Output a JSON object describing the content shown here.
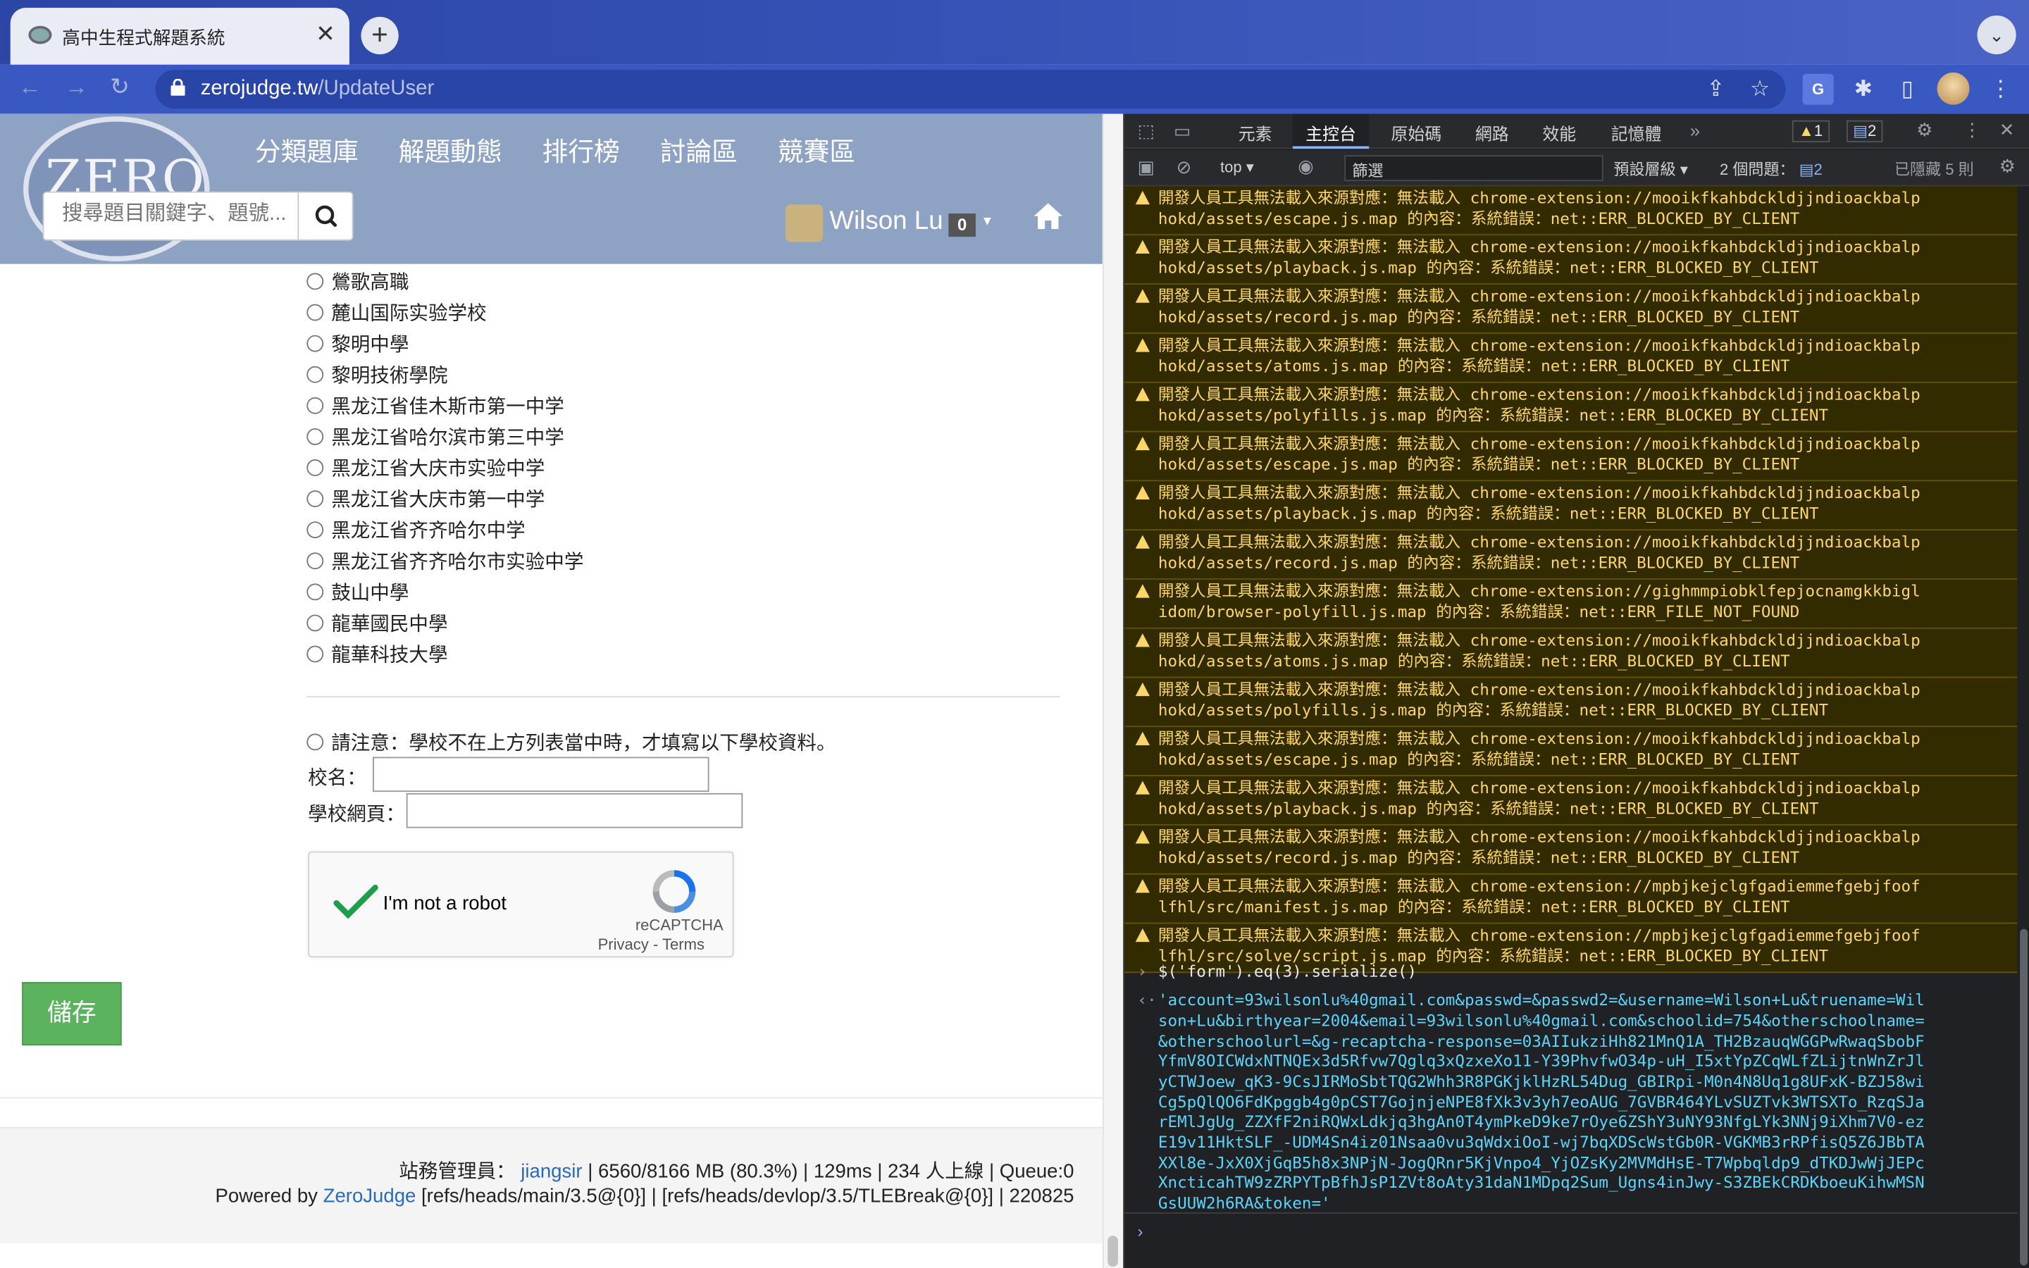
{
  "browser": {
    "tab_title": "高中生程式解題系統",
    "url_host": "zerojudge.tw",
    "url_path": "/UpdateUser"
  },
  "site": {
    "logo_text": "ZERO",
    "menu": [
      "分類題庫",
      "解題動態",
      "排行榜",
      "討論區",
      "競賽區"
    ],
    "search_placeholder": "搜尋題目關鍵字、題號...",
    "user_name": "Wilson Lu",
    "user_badge": "0"
  },
  "form": {
    "schools": [
      "鶯歌高職",
      "麓山国际实验学校",
      "黎明中學",
      "黎明技術學院",
      "黑龙江省佳木斯市第一中学",
      "黑龙江省哈尔滨市第三中学",
      "黑龙江省大庆市实验中学",
      "黑龙江省大庆市第一中学",
      "黑龙江省齐齐哈尔中学",
      "黑龙江省齐齐哈尔市实验中学",
      "鼓山中學",
      "龍華國民中學",
      "龍華科技大學"
    ],
    "other_note": "請注意：學校不在上方列表當中時，才填寫以下學校資料。",
    "school_name_label": "校名：",
    "school_url_label": "學校網頁：",
    "captcha_label": "I'm not a robot",
    "captcha_brand": "reCAPTCHA",
    "captcha_links": "Privacy - Terms",
    "save_label": "儲存"
  },
  "footer": {
    "admin_label": "站務管理員：",
    "admin_name": "jiangsir",
    "stats": "| 6560/8166 MB (80.3%) | 129ms | 234 人上線 | Queue:0",
    "powered_prefix": "Powered by",
    "powered_name": "ZeroJudge",
    "refs": "[refs/heads/main/3.5@{0}] | [refs/heads/devlop/3.5/TLEBreak@{0}] | 220825"
  },
  "devtools": {
    "tabs": [
      "元素",
      "主控台",
      "原始碼",
      "網路",
      "效能",
      "記憶體"
    ],
    "active_tab": "主控台",
    "warn_count": "1",
    "msg_count": "2",
    "context": "top",
    "filter_placeholder": "篩選",
    "levels": "預設層級",
    "issues": "2 個問題：",
    "issues_count": "2",
    "hidden": "已隱藏 5 則",
    "warnings": [
      {
        "l1": "開發人員工具無法載入來源對應：無法載入 chrome-extension://mooikfkahbdckldjjndioackbalp",
        "l2": "hokd/assets/escape.js.map 的內容：系統錯誤：net::ERR_BLOCKED_BY_CLIENT"
      },
      {
        "l1": "開發人員工具無法載入來源對應：無法載入 chrome-extension://mooikfkahbdckldjjndioackbalp",
        "l2": "hokd/assets/playback.js.map 的內容：系統錯誤：net::ERR_BLOCKED_BY_CLIENT"
      },
      {
        "l1": "開發人員工具無法載入來源對應：無法載入 chrome-extension://mooikfkahbdckldjjndioackbalp",
        "l2": "hokd/assets/record.js.map 的內容：系統錯誤：net::ERR_BLOCKED_BY_CLIENT"
      },
      {
        "l1": "開發人員工具無法載入來源對應：無法載入 chrome-extension://mooikfkahbdckldjjndioackbalp",
        "l2": "hokd/assets/atoms.js.map 的內容：系統錯誤：net::ERR_BLOCKED_BY_CLIENT"
      },
      {
        "l1": "開發人員工具無法載入來源對應：無法載入 chrome-extension://mooikfkahbdckldjjndioackbalp",
        "l2": "hokd/assets/polyfills.js.map 的內容：系統錯誤：net::ERR_BLOCKED_BY_CLIENT"
      },
      {
        "l1": "開發人員工具無法載入來源對應：無法載入 chrome-extension://mooikfkahbdckldjjndioackbalp",
        "l2": "hokd/assets/escape.js.map 的內容：系統錯誤：net::ERR_BLOCKED_BY_CLIENT"
      },
      {
        "l1": "開發人員工具無法載入來源對應：無法載入 chrome-extension://mooikfkahbdckldjjndioackbalp",
        "l2": "hokd/assets/playback.js.map 的內容：系統錯誤：net::ERR_BLOCKED_BY_CLIENT"
      },
      {
        "l1": "開發人員工具無法載入來源對應：無法載入 chrome-extension://mooikfkahbdckldjjndioackbalp",
        "l2": "hokd/assets/record.js.map 的內容：系統錯誤：net::ERR_BLOCKED_BY_CLIENT"
      },
      {
        "l1": "開發人員工具無法載入來源對應：無法載入 chrome-extension://gighmmpiobklfepjocnamgkkbigl",
        "l2": "idom/browser-polyfill.js.map 的內容：系統錯誤：net::ERR_FILE_NOT_FOUND"
      },
      {
        "l1": "開發人員工具無法載入來源對應：無法載入 chrome-extension://mooikfkahbdckldjjndioackbalp",
        "l2": "hokd/assets/atoms.js.map 的內容：系統錯誤：net::ERR_BLOCKED_BY_CLIENT"
      },
      {
        "l1": "開發人員工具無法載入來源對應：無法載入 chrome-extension://mooikfkahbdckldjjndioackbalp",
        "l2": "hokd/assets/polyfills.js.map 的內容：系統錯誤：net::ERR_BLOCKED_BY_CLIENT"
      },
      {
        "l1": "開發人員工具無法載入來源對應：無法載入 chrome-extension://mooikfkahbdckldjjndioackbalp",
        "l2": "hokd/assets/escape.js.map 的內容：系統錯誤：net::ERR_BLOCKED_BY_CLIENT"
      },
      {
        "l1": "開發人員工具無法載入來源對應：無法載入 chrome-extension://mooikfkahbdckldjjndioackbalp",
        "l2": "hokd/assets/playback.js.map 的內容：系統錯誤：net::ERR_BLOCKED_BY_CLIENT"
      },
      {
        "l1": "開發人員工具無法載入來源對應：無法載入 chrome-extension://mooikfkahbdckldjjndioackbalp",
        "l2": "hokd/assets/record.js.map 的內容：系統錯誤：net::ERR_BLOCKED_BY_CLIENT"
      },
      {
        "l1": "開發人員工具無法載入來源對應：無法載入 chrome-extension://mpbjkejclgfgadiemmefgebjfoof",
        "l2": "lfhl/src/manifest.js.map 的內容：系統錯誤：net::ERR_BLOCKED_BY_CLIENT"
      },
      {
        "l1": "開發人員工具無法載入來源對應：無法載入 chrome-extension://mpbjkejclgfgadiemmefgebjfoof",
        "l2": "lfhl/src/solve/script.js.map 的內容：系統錯誤：net::ERR_BLOCKED_BY_CLIENT"
      }
    ],
    "command": "$('form').eq(3).serialize()",
    "result_lines": [
      "'account=93wilsonlu%40gmail.com&passwd=&passwd2=&username=Wilson+Lu&truename=Wil",
      "son+Lu&birthyear=2004&email=93wilsonlu%40gmail.com&schoolid=754&otherschoolname=",
      "&otherschoolurl=&g-recaptcha-response=03AIIukziHh821MnQ1A_TH2BzauqWGGPwRwaqSbobF",
      "YfmV8OICWdxNTNQEx3d5Rfvw7Qglq3xQzxeXo11-Y39PhvfwO34p-uH_I5xtYpZCqWLfZLijtnWnZrJl",
      "yCTWJoew_qK3-9CsJIRMoSbtTQG2Whh3R8PGKjklHzRL54Dug_GBIRpi-M0n4N8Uq1g8UFxK-BZJ58wi",
      "Cg5pQlQO6FdKpggb4g0pCST7GojnjeNPE8fXk3v3yh7eoAUG_7GVBR464YLvSUZTvk3WTSXTo_RzqSJa",
      "rEMlJgUg_ZZXfF2niRQWxLdkjq3hgAn0T4ymPkeD9ke7rOye6ZShY3uNY93NfgLYk3NNj9iXhm7V0-ez",
      "E19v11HktSLF_-UDM4Sn4iz01Nsaa0vu3qWdxiOoI-wj7bqXDScWstGb0R-VGKMB3rRPfisQ5Z6JBbTA",
      "XXl8e-JxX0XjGqB5h8x3NPjN-JogQRnr5KjVnpo4_YjOZsKy2MVMdHsE-T7Wpbqldp9_dTKDJwWjJEPc",
      "XncticahTW9zZRPYTpBfhJsP1ZVt8oAty31daN1MDpq2Sum_Ugns4inJwy-S3ZBEkCRDKboeuKihwMSN",
      "GsUUW2h6RA&token='"
    ]
  }
}
